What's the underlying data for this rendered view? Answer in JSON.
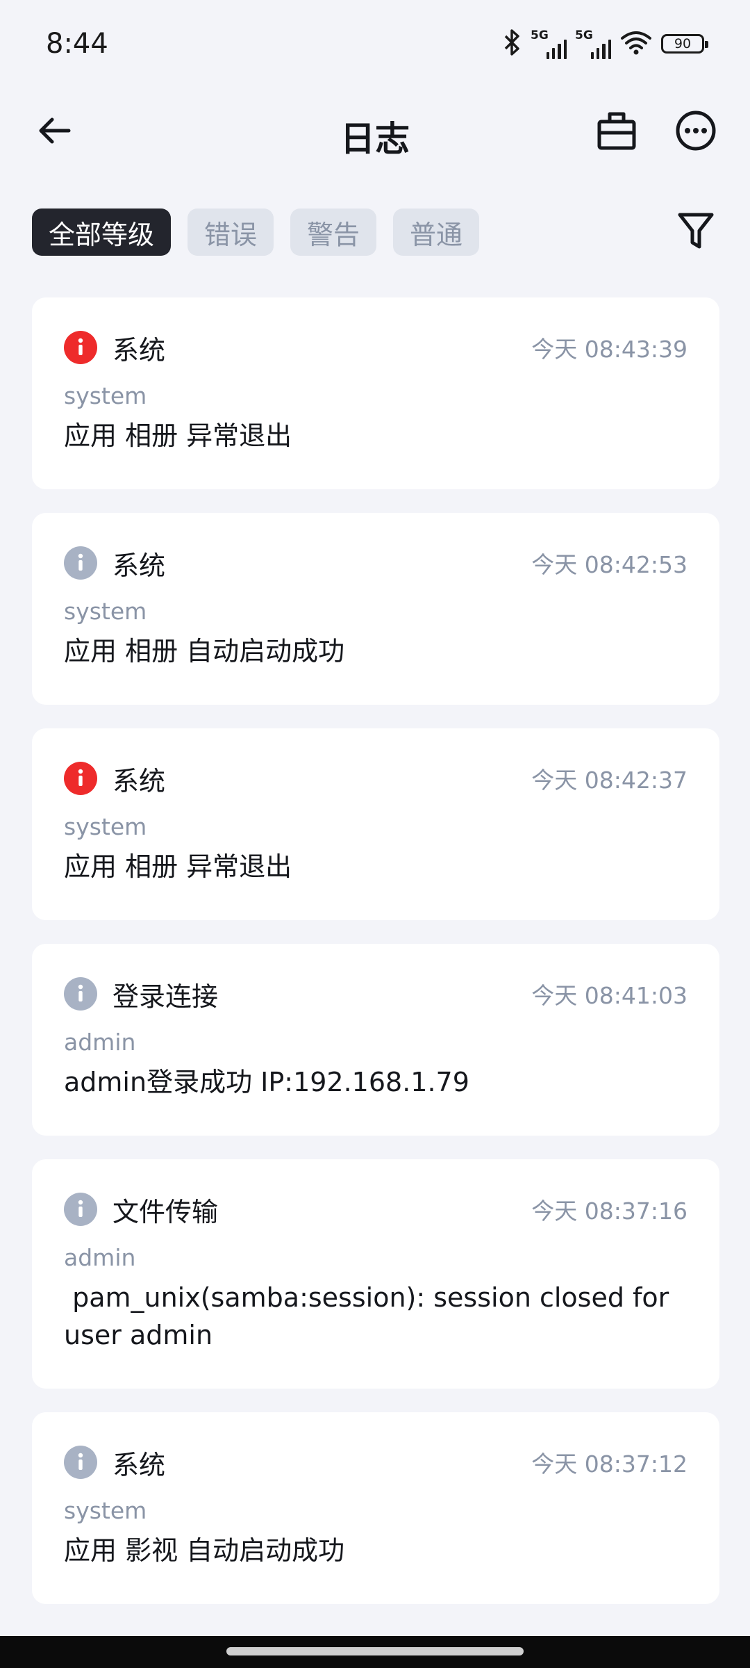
{
  "status_bar": {
    "time": "8:44",
    "network_1": "5G",
    "network_2": "5G",
    "battery": "90"
  },
  "header": {
    "title": "日志"
  },
  "filters": {
    "chips": [
      {
        "label": "全部等级",
        "active": true
      },
      {
        "label": "错误",
        "active": false
      },
      {
        "label": "警告",
        "active": false
      },
      {
        "label": "普通",
        "active": false
      }
    ]
  },
  "logs": [
    {
      "level": "error",
      "category": "系统",
      "time": "今天 08:43:39",
      "source": "system",
      "message": "应用 相册 异常退出"
    },
    {
      "level": "info",
      "category": "系统",
      "time": "今天 08:42:53",
      "source": "system",
      "message": "应用 相册 自动启动成功"
    },
    {
      "level": "error",
      "category": "系统",
      "time": "今天 08:42:37",
      "source": "system",
      "message": "应用 相册 异常退出"
    },
    {
      "level": "info",
      "category": "登录连接",
      "time": "今天 08:41:03",
      "source": "admin",
      "message": "admin登录成功 IP:192.168.1.79"
    },
    {
      "level": "info",
      "category": "文件传输",
      "time": "今天 08:37:16",
      "source": "admin",
      "message": " pam_unix(samba:session): session closed for user admin"
    },
    {
      "level": "info",
      "category": "系统",
      "time": "今天 08:37:12",
      "source": "system",
      "message": "应用 影视 自动启动成功"
    }
  ],
  "colors": {
    "error": "#ee2b2b",
    "info": "#a8b2c4",
    "active_chip": "#23252d",
    "background": "#f3f4f9"
  }
}
